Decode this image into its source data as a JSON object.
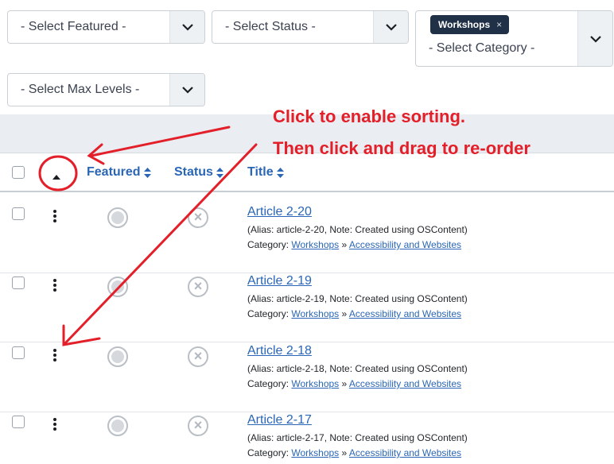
{
  "filters": {
    "featured": "- Select Featured -",
    "status": "- Select Status -",
    "category": "- Select Category -",
    "category_tag": "Workshops",
    "category_tag_remove": "×",
    "max_levels": "- Select Max Levels -"
  },
  "table": {
    "columns": {
      "featured": "Featured",
      "status": "Status",
      "title": "Title"
    },
    "rows": [
      {
        "title": "Article 2-20",
        "alias": "(Alias: article-2-20, Note: Created using OSContent)",
        "category_prefix": "Category:",
        "category_parent": "Workshops",
        "category_sep": "»",
        "category": "Accessibility and Websites"
      },
      {
        "title": "Article 2-19",
        "alias": "(Alias: article-2-19, Note: Created using OSContent)",
        "category_prefix": "Category:",
        "category_parent": "Workshops",
        "category_sep": "»",
        "category": "Accessibility and Websites"
      },
      {
        "title": "Article 2-18",
        "alias": "(Alias: article-2-18, Note: Created using OSContent)",
        "category_prefix": "Category:",
        "category_parent": "Workshops",
        "category_sep": "»",
        "category": "Accessibility and Websites"
      },
      {
        "title": "Article 2-17",
        "alias": "(Alias: article-2-17, Note: Created using OSContent)",
        "category_prefix": "Category:",
        "category_parent": "Workshops",
        "category_sep": "»",
        "category": "Accessibility and Websites"
      }
    ]
  },
  "annotation": {
    "line1": "Click to enable sorting.",
    "line2": "Then click and drag to re-order",
    "color": "#e3202a"
  },
  "colors": {
    "link": "#2a66b5",
    "tag_bg": "#1f3047"
  }
}
